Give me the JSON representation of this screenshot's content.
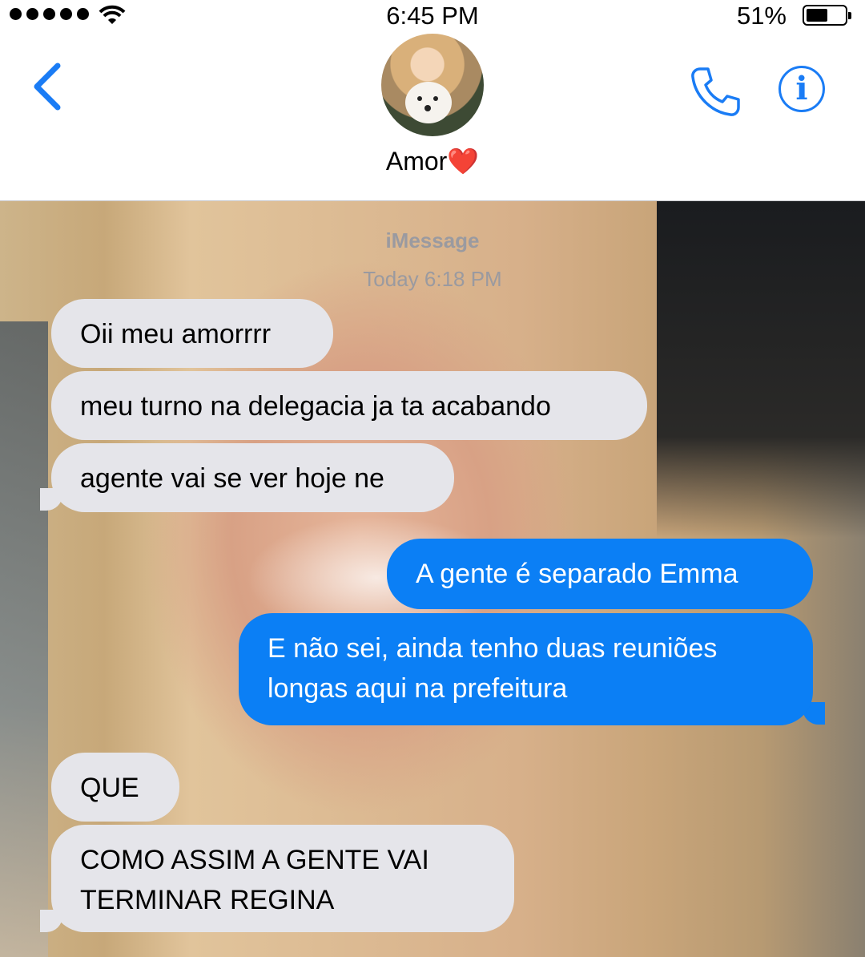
{
  "status_bar": {
    "time": "6:45 PM",
    "battery_percent": "51%",
    "signal_bars": 5,
    "battery_level": 0.51
  },
  "header": {
    "contact_name": "Amor",
    "contact_emoji": "❤️",
    "accent_color": "#1a7cf5"
  },
  "thread": {
    "service_label": "iMessage",
    "timestamp": "Today 6:18 PM",
    "messages": [
      {
        "from": "them",
        "text": "Oii meu amorrrr"
      },
      {
        "from": "them",
        "text": "meu turno na delegacia ja ta acabando"
      },
      {
        "from": "them",
        "text": "agente vai se ver hoje ne"
      },
      {
        "from": "me",
        "text": "A gente é separado Emma"
      },
      {
        "from": "me",
        "text": "E não sei, ainda tenho duas reuniões longas aqui na prefeitura"
      },
      {
        "from": "them",
        "text": "QUE"
      },
      {
        "from": "them",
        "text": "COMO ASSIM A GENTE VAI TERMINAR REGINA"
      }
    ],
    "incoming_bubble_color": "#e5e5ea",
    "outgoing_bubble_color": "#0b7ff5"
  }
}
